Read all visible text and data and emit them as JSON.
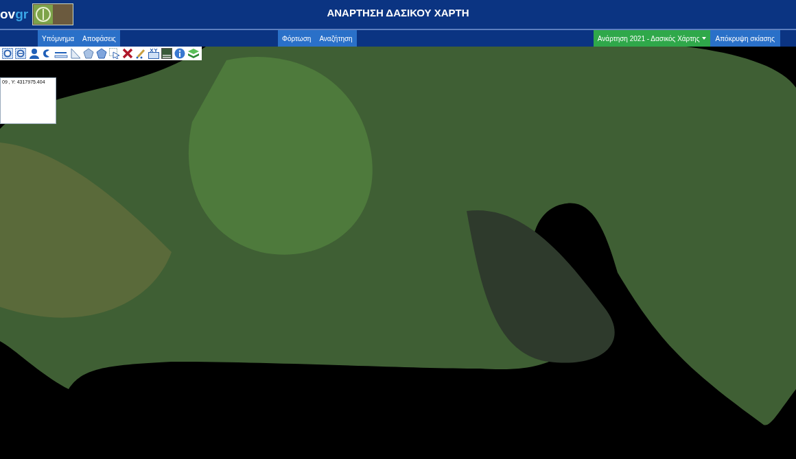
{
  "header": {
    "logo_prefix": "ov",
    "logo_suffix": "gr",
    "title": "ΑΝΑΡΤΗΣΗ ΔΑΣΙΚΟΥ ΧΑΡΤΗ"
  },
  "nav": {
    "left_tabs": [
      {
        "label": "Υπόμνημα"
      },
      {
        "label": "Αποφάσεις"
      }
    ],
    "center_tabs": [
      {
        "label": "Φόρτωση"
      },
      {
        "label": "Αναζήτηση"
      }
    ],
    "dropdown": {
      "label": "Ανάρτηση 2021 - Δασικός Χάρτης"
    },
    "hide_button": {
      "label": "Απόκρυψη σκίασης"
    }
  },
  "coordinates": {
    "text": "09 , Y: 4317975.404"
  }
}
